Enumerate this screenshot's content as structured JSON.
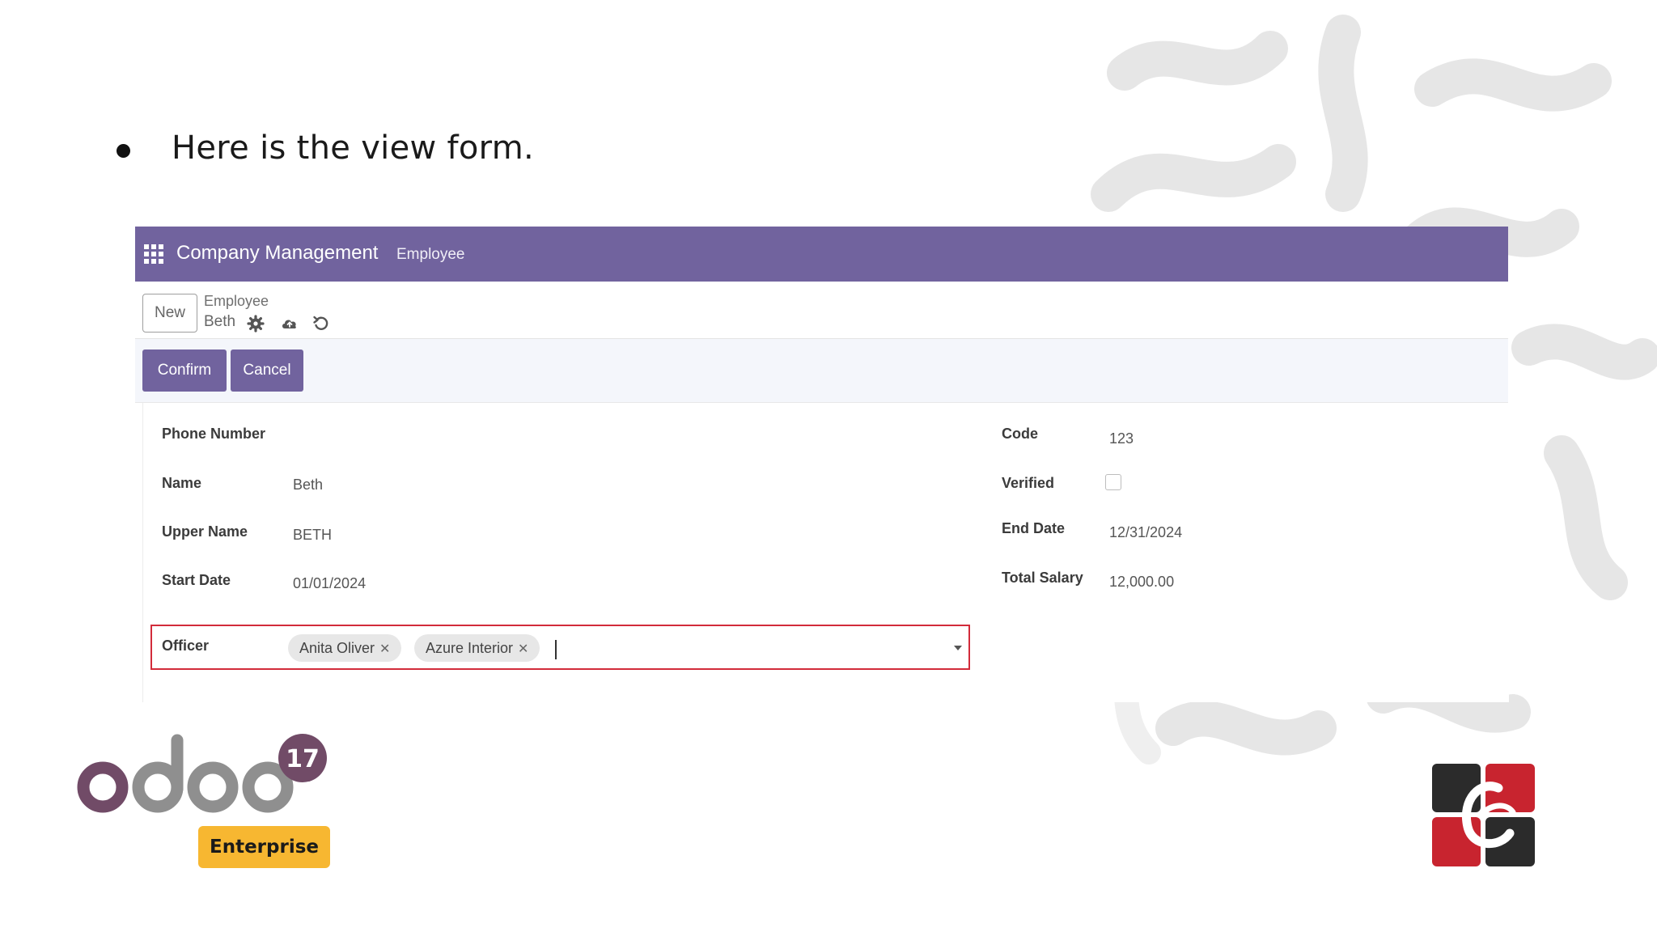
{
  "slide": {
    "bullet_text": "Here is the view form."
  },
  "navbar": {
    "app_title": "Company Management",
    "menu_item": "Employee"
  },
  "controlbar": {
    "new_label": "New",
    "breadcrumb_parent": "Employee",
    "breadcrumb_current": "Beth"
  },
  "statusbar": {
    "confirm_label": "Confirm",
    "cancel_label": "Cancel"
  },
  "form": {
    "left": [
      {
        "label": "Phone Number",
        "value": ""
      },
      {
        "label": "Name",
        "value": "Beth"
      },
      {
        "label": "Upper Name",
        "value": "BETH"
      },
      {
        "label": "Start Date",
        "value": "01/01/2024"
      }
    ],
    "right": [
      {
        "label": "Code",
        "value": "123"
      },
      {
        "label": "Verified",
        "value": false
      },
      {
        "label": "End Date",
        "value": "12/31/2024"
      },
      {
        "label": "Total Salary",
        "value": "12,000.00"
      }
    ],
    "officer": {
      "label": "Officer",
      "tags": [
        "Anita Oliver",
        "Azure Interior"
      ]
    }
  },
  "logo": {
    "brand": "odoo",
    "version": "17",
    "edition": "Enterprise"
  },
  "colors": {
    "navbar": "#71639e",
    "primary_button": "#71639e",
    "highlight_border": "#d22b3a",
    "enterprise_badge": "#f7b731"
  }
}
